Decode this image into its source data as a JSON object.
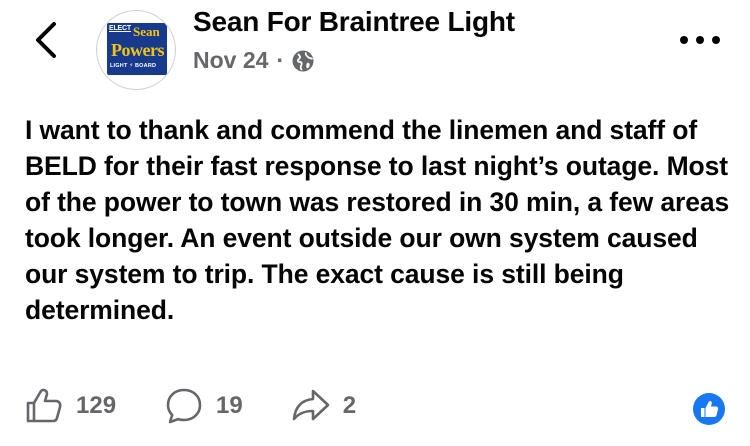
{
  "header": {
    "page_name": "Sean For Braintree Light",
    "date": "Nov 24",
    "separator": "·",
    "privacy_icon": "globe-icon",
    "back_icon": "chevron-left-icon",
    "more_icon": "more-horizontal-icon"
  },
  "avatar": {
    "elect": "ELECT",
    "first_name": "Sean",
    "last_name": "Powers",
    "tagline": "LIGHT ⚡ BOARD",
    "colors": {
      "background": "#173a8c",
      "accent": "#f3c316"
    }
  },
  "post": {
    "text": "I want to thank and commend the linemen and staff of BELD for their fast response to last night’s outage. Most of the power to town was restored in 30 min, a few areas took longer. An event outside our own system caused our system to trip. The exact cause is still being determined."
  },
  "actions": {
    "like": {
      "icon": "thumbs-up-icon",
      "count": "129"
    },
    "comment": {
      "icon": "comment-icon",
      "count": "19"
    },
    "share": {
      "icon": "share-icon",
      "count": "2"
    }
  },
  "reaction_badge": {
    "icon": "like-reaction-icon",
    "color": "#1877f2"
  }
}
